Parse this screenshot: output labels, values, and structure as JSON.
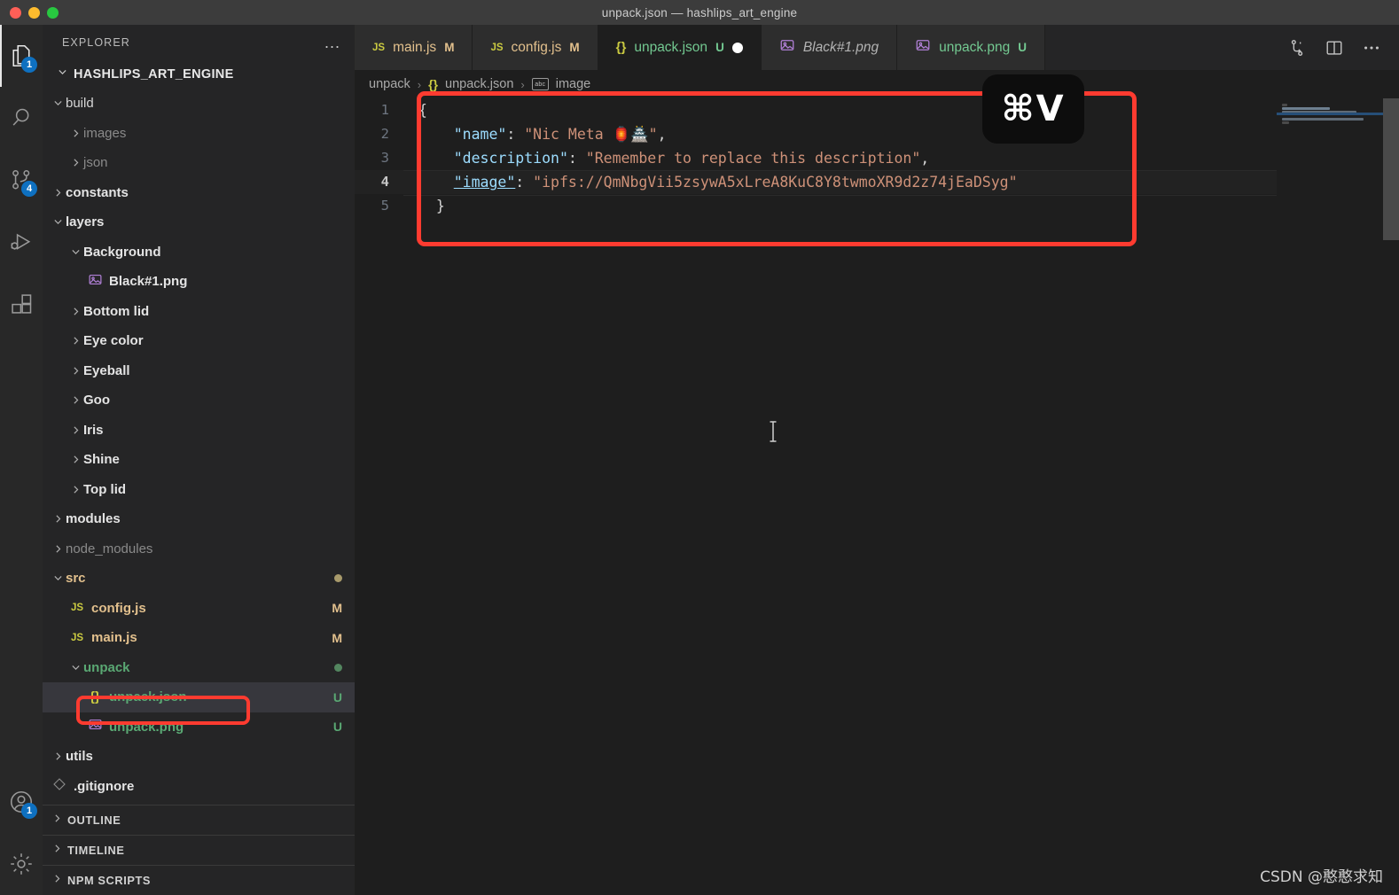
{
  "window": {
    "title": "unpack.json — hashlips_art_engine",
    "controls": [
      "close",
      "minimize",
      "maximize"
    ]
  },
  "activity_bar": {
    "items": [
      {
        "name": "explorer",
        "icon": "files-icon",
        "badge": "1",
        "active": true
      },
      {
        "name": "search",
        "icon": "search-icon",
        "badge": "",
        "active": false
      },
      {
        "name": "source-control",
        "icon": "source-control-icon",
        "badge": "4",
        "active": false
      },
      {
        "name": "run-and-debug",
        "icon": "run-debug-icon",
        "badge": "",
        "active": false
      },
      {
        "name": "extensions",
        "icon": "extensions-icon",
        "badge": "",
        "active": false
      }
    ],
    "bottom_items": [
      {
        "name": "accounts",
        "icon": "account-icon",
        "badge": "1"
      },
      {
        "name": "manage",
        "icon": "gear-icon",
        "badge": ""
      }
    ]
  },
  "sidebar": {
    "header": {
      "title": "EXPLORER",
      "more_actions": "..."
    },
    "root_folder": "HASHLIPS_ART_ENGINE",
    "tree": [
      {
        "label": "build",
        "indent": 1,
        "type": "folder",
        "expanded": true,
        "style": "normal",
        "badge": ""
      },
      {
        "label": "images",
        "indent": 2,
        "type": "folder",
        "expanded": false,
        "style": "dim",
        "badge": ""
      },
      {
        "label": "json",
        "indent": 2,
        "type": "folder",
        "expanded": false,
        "style": "dim",
        "badge": ""
      },
      {
        "label": "constants",
        "indent": 1,
        "type": "folder",
        "expanded": false,
        "style": "bold",
        "badge": ""
      },
      {
        "label": "layers",
        "indent": 1,
        "type": "folder",
        "expanded": true,
        "style": "bold",
        "badge": ""
      },
      {
        "label": "Background",
        "indent": 2,
        "type": "folder",
        "expanded": true,
        "style": "bold",
        "badge": ""
      },
      {
        "label": "Black#1.png",
        "indent": 3,
        "type": "image",
        "expanded": false,
        "style": "bold",
        "badge": ""
      },
      {
        "label": "Bottom lid",
        "indent": 2,
        "type": "folder",
        "expanded": false,
        "style": "bold",
        "badge": ""
      },
      {
        "label": "Eye color",
        "indent": 2,
        "type": "folder",
        "expanded": false,
        "style": "bold",
        "badge": ""
      },
      {
        "label": "Eyeball",
        "indent": 2,
        "type": "folder",
        "expanded": false,
        "style": "bold",
        "badge": ""
      },
      {
        "label": "Goo",
        "indent": 2,
        "type": "folder",
        "expanded": false,
        "style": "bold",
        "badge": ""
      },
      {
        "label": "Iris",
        "indent": 2,
        "type": "folder",
        "expanded": false,
        "style": "bold",
        "badge": ""
      },
      {
        "label": "Shine",
        "indent": 2,
        "type": "folder",
        "expanded": false,
        "style": "bold",
        "badge": ""
      },
      {
        "label": "Top lid",
        "indent": 2,
        "type": "folder",
        "expanded": false,
        "style": "bold",
        "badge": ""
      },
      {
        "label": "modules",
        "indent": 1,
        "type": "folder",
        "expanded": false,
        "style": "bold",
        "badge": ""
      },
      {
        "label": "node_modules",
        "indent": 1,
        "type": "folder",
        "expanded": false,
        "style": "dim",
        "badge": ""
      },
      {
        "label": "src",
        "indent": 1,
        "type": "folder",
        "expanded": true,
        "style": "mod",
        "badge": "dot-y"
      },
      {
        "label": "config.js",
        "indent": 2,
        "type": "js",
        "expanded": false,
        "style": "mod",
        "badge": "M"
      },
      {
        "label": "main.js",
        "indent": 2,
        "type": "js",
        "expanded": false,
        "style": "mod",
        "badge": "M"
      },
      {
        "label": "unpack",
        "indent": 2,
        "type": "folder",
        "expanded": true,
        "style": "untracked",
        "badge": "dot-g"
      },
      {
        "label": "unpack.json",
        "indent": 3,
        "type": "json",
        "expanded": false,
        "style": "untracked",
        "badge": "U",
        "selected": true,
        "annotated": true
      },
      {
        "label": "unpack.png",
        "indent": 3,
        "type": "image",
        "expanded": false,
        "style": "untracked",
        "badge": "U"
      },
      {
        "label": "utils",
        "indent": 1,
        "type": "folder",
        "expanded": false,
        "style": "bold",
        "badge": ""
      },
      {
        "label": ".gitignore",
        "indent": 1,
        "type": "git",
        "expanded": false,
        "style": "bold",
        "badge": ""
      }
    ],
    "sections": [
      {
        "label": "OUTLINE"
      },
      {
        "label": "TIMELINE"
      },
      {
        "label": "NPM SCRIPTS"
      }
    ]
  },
  "editor": {
    "tabs": [
      {
        "label": "main.js",
        "icon": "js-icon",
        "badge": "M",
        "style": "mod",
        "active": false,
        "dirty": false
      },
      {
        "label": "config.js",
        "icon": "js-icon",
        "badge": "M",
        "style": "mod",
        "active": false,
        "dirty": false
      },
      {
        "label": "unpack.json",
        "icon": "json-icon",
        "badge": "U",
        "style": "untracked",
        "active": true,
        "dirty": true
      },
      {
        "label": "Black#1.png",
        "icon": "image-icon",
        "badge": "",
        "style": "preview",
        "active": false,
        "dirty": false
      },
      {
        "label": "unpack.png",
        "icon": "image-icon",
        "badge": "U",
        "style": "untracked",
        "active": false,
        "dirty": false
      }
    ],
    "tab_actions": [
      {
        "name": "split-editor-vertical-icon",
        "glyph": "split"
      },
      {
        "name": "split-editor-icon",
        "glyph": "panel"
      },
      {
        "name": "more-actions-icon",
        "glyph": "dots"
      }
    ],
    "breadcrumbs": [
      {
        "label": "unpack",
        "icon": ""
      },
      {
        "label": "unpack.json",
        "icon": "json-icon"
      },
      {
        "label": "image",
        "icon": "abc-icon"
      }
    ],
    "code_lines": [
      {
        "num": "1",
        "current": false
      },
      {
        "num": "2",
        "current": false
      },
      {
        "num": "3",
        "current": false
      },
      {
        "num": "4",
        "current": true
      },
      {
        "num": "5",
        "current": false
      }
    ],
    "code": {
      "line1": "{",
      "line2_key": "\"name\"",
      "line2_value": "\"Nic Meta 🏮🏯\"",
      "line3_key": "\"description\"",
      "line3_value": "\"Remember to replace this description\"",
      "line4_key": "\"image\"",
      "line4_value": "\"ipfs://QmNbgVii5zsywA5xLreA8KuC8Y8twmoXR9d2z74jEaDSyg\"",
      "line5": "}",
      "colon": ":",
      "comma": ","
    },
    "keyboard_overlay": "⌘V"
  },
  "watermark": "CSDN @憨憨求知",
  "colors": {
    "accent_red": "#ff3b30",
    "badge_blue": "#0e70c0",
    "modified": "#e2c08d",
    "untracked": "#73c991",
    "string": "#ce9178",
    "key": "#9cdcfe"
  }
}
